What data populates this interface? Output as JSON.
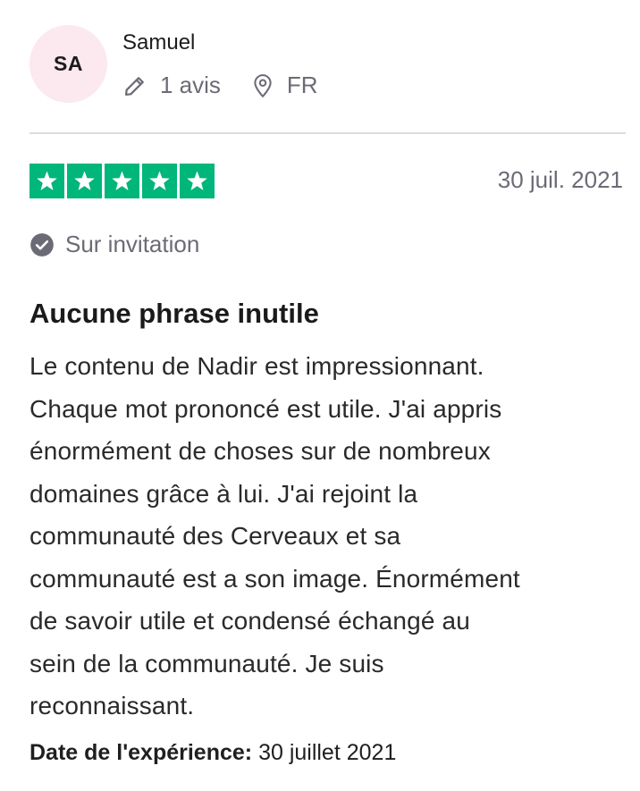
{
  "reviewer": {
    "initials": "SA",
    "name": "Samuel",
    "reviews_count": "1 avis",
    "country": "FR"
  },
  "review": {
    "rating": 5,
    "rating_max": 5,
    "date": "30 juil. 2021",
    "invitation_label": "Sur invitation",
    "title": "Aucune phrase inutile",
    "body_lines": [
      "Le contenu de Nadir est impressionnant.",
      "Chaque mot prononcé est utile. J'ai appris",
      "énormément de choses sur de nombreux",
      "domaines grâce à lui. J'ai rejoint la",
      "communauté des Cerveaux et sa",
      "communauté est a son image. Énormément",
      "de savoir utile et condensé échangé au",
      "sein de la communauté. Je suis",
      "reconnaissant."
    ],
    "experience_label": "Date de l'expérience:",
    "experience_date": "30 juillet 2021"
  },
  "colors": {
    "star_green": "#00b67a",
    "avatar_bg": "#fbe9ef",
    "muted_text": "#6b6b76",
    "divider": "#dcdce2"
  },
  "icons": {
    "reviews": "pencil-icon",
    "country": "location-pin-icon",
    "invitation": "check-circle-icon",
    "star": "star-icon"
  }
}
